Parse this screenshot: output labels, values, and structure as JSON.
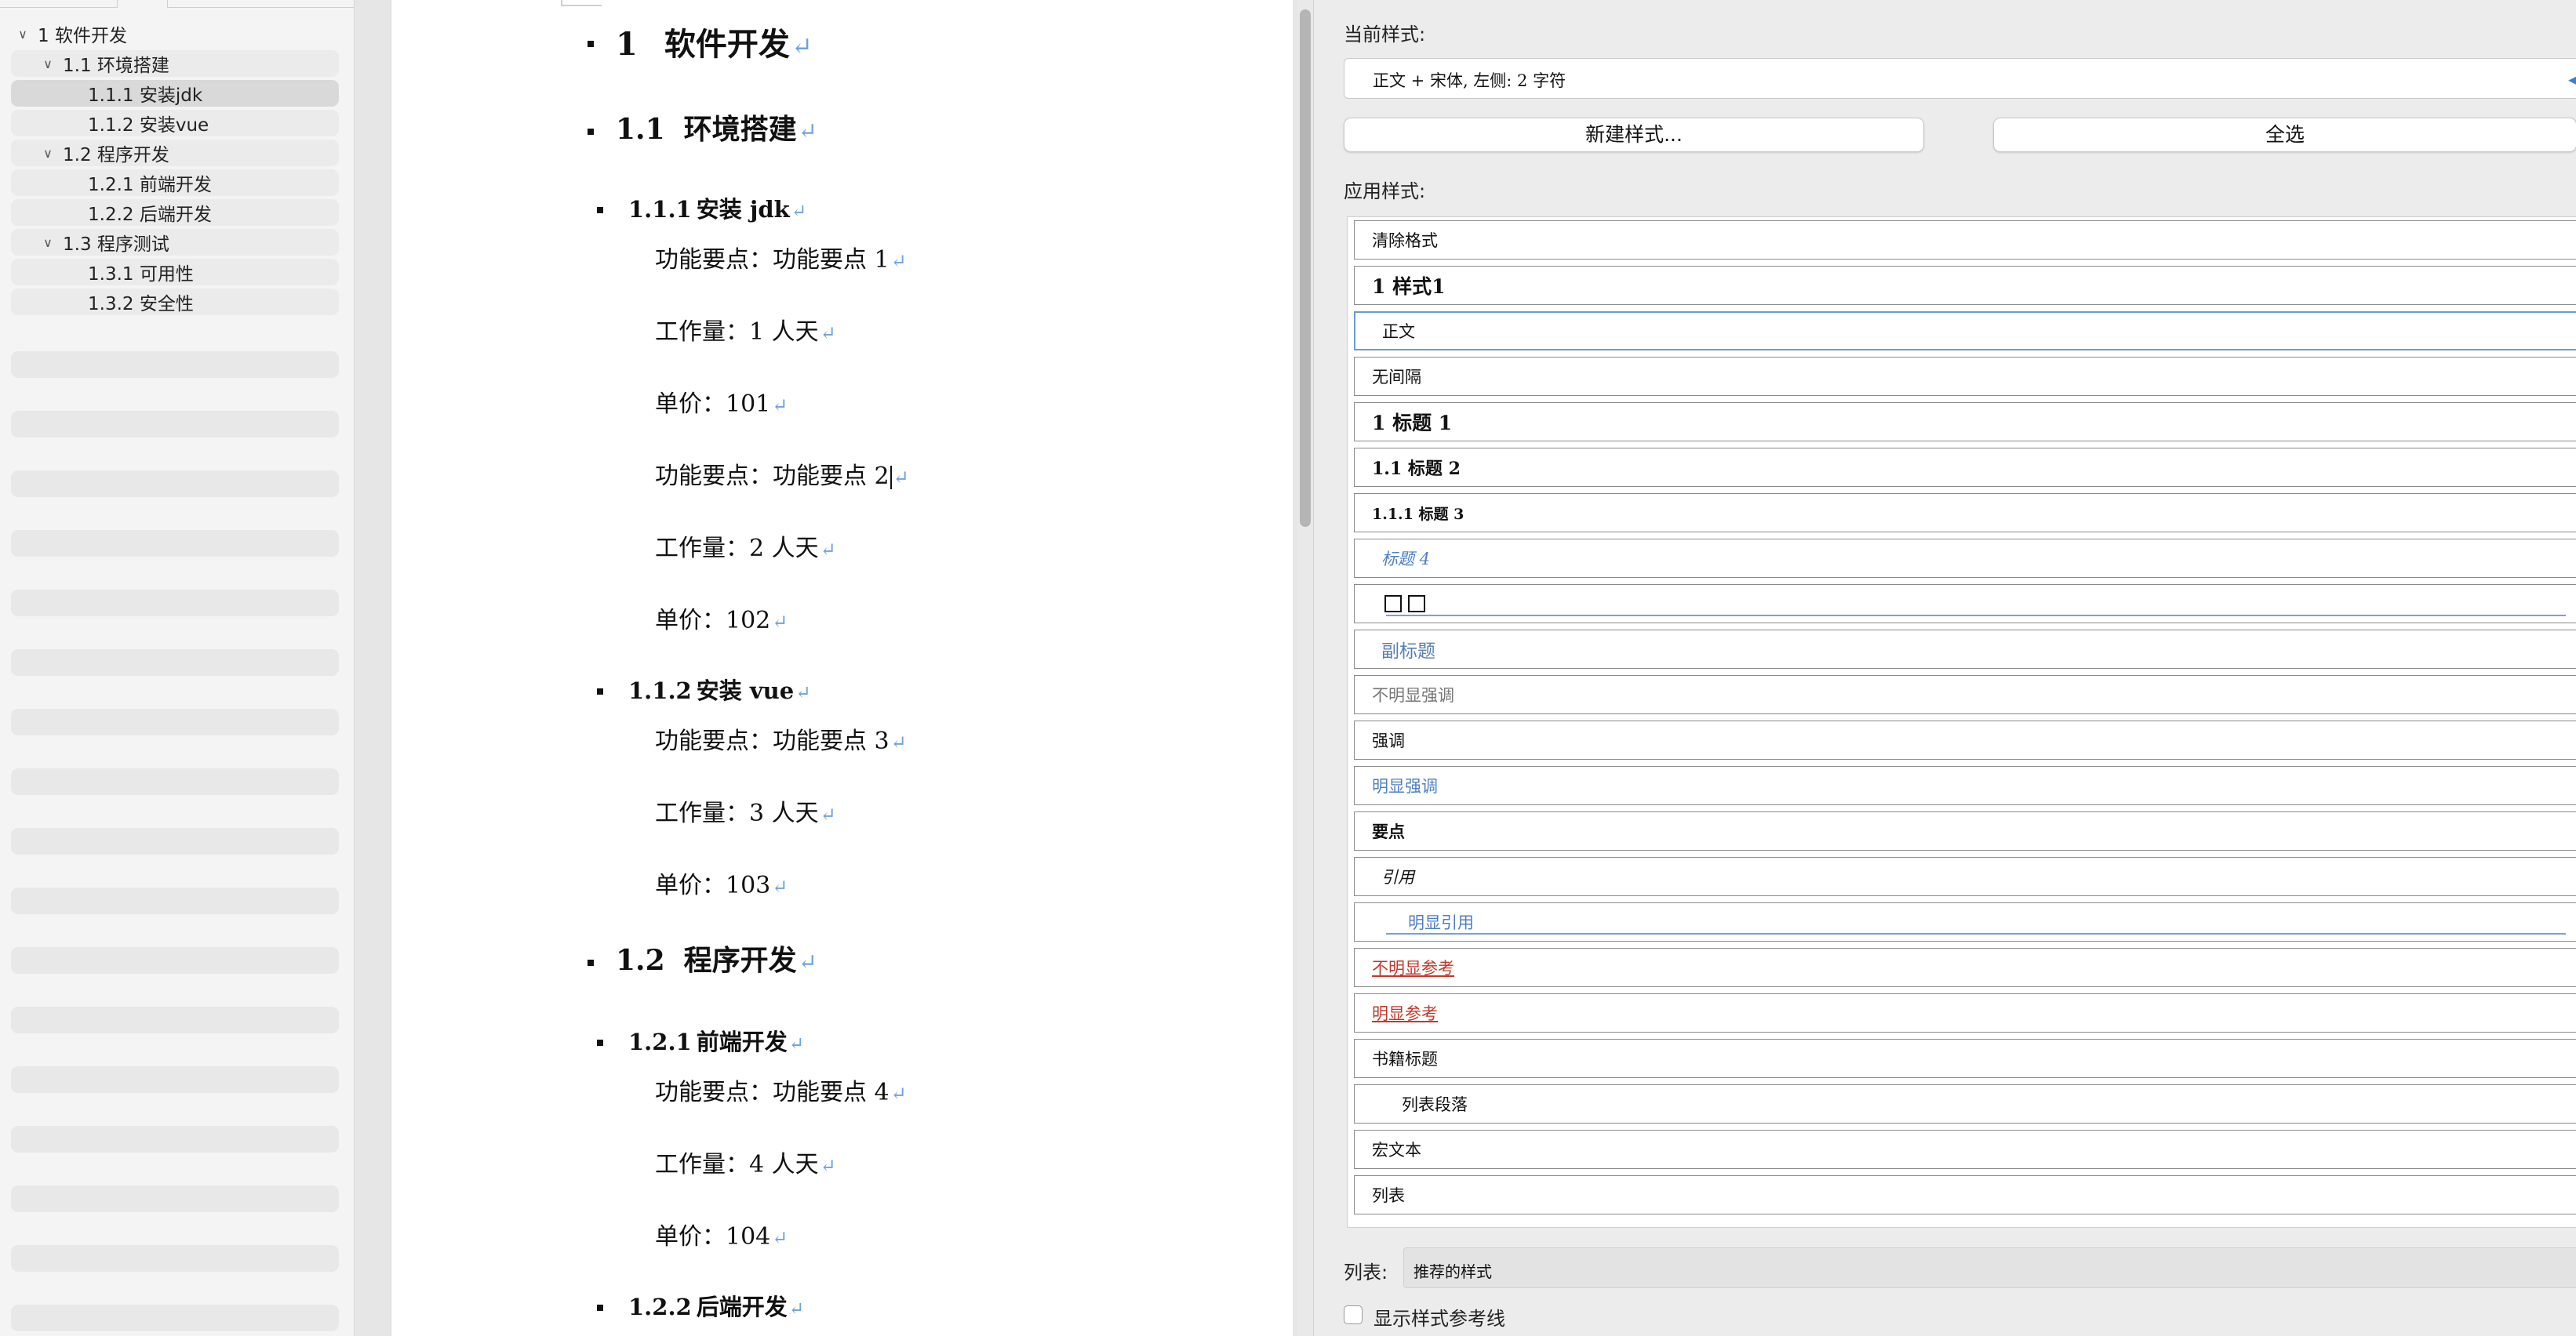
{
  "nav": {
    "items": [
      {
        "label": "1 软件开发",
        "level": 0,
        "expanded": true
      },
      {
        "label": "1.1 环境搭建",
        "level": 1,
        "expanded": true
      },
      {
        "label": "1.1.1 安装jdk",
        "level": 2,
        "selected": true
      },
      {
        "label": "1.1.2 安装vue",
        "level": 2
      },
      {
        "label": "1.2 程序开发",
        "level": 1,
        "expanded": true
      },
      {
        "label": "1.2.1 前端开发",
        "level": 2
      },
      {
        "label": "1.2.2 后端开发",
        "level": 2
      },
      {
        "label": "1.3 程序测试",
        "level": 1,
        "expanded": true
      },
      {
        "label": "1.3.1 可用性",
        "level": 2
      },
      {
        "label": "1.3.2 安全性",
        "level": 2
      }
    ]
  },
  "document": {
    "paragraphs": [
      {
        "type": "h1",
        "num": "1",
        "text": "软件开发"
      },
      {
        "type": "h2",
        "num": "1.1",
        "text": "环境搭建"
      },
      {
        "type": "h3",
        "num": "1.1.1",
        "text": "安装 jdk"
      },
      {
        "type": "body",
        "text": "功能要点：功能要点 1"
      },
      {
        "type": "body",
        "text": "工作量：1 人天"
      },
      {
        "type": "body",
        "text": "单价：101"
      },
      {
        "type": "body",
        "text": "功能要点：功能要点 2",
        "caret": true
      },
      {
        "type": "body",
        "text": "工作量：2 人天"
      },
      {
        "type": "body",
        "text": "单价：102"
      },
      {
        "type": "h3",
        "num": "1.1.2",
        "text": "安装 vue"
      },
      {
        "type": "body",
        "text": "功能要点：功能要点 3"
      },
      {
        "type": "body",
        "text": "工作量：3 人天"
      },
      {
        "type": "body",
        "text": "单价：103"
      },
      {
        "type": "h2",
        "num": "1.2",
        "text": "程序开发"
      },
      {
        "type": "h3",
        "num": "1.2.1",
        "text": "前端开发"
      },
      {
        "type": "body",
        "text": "功能要点：功能要点 4"
      },
      {
        "type": "body",
        "text": "工作量：4 人天"
      },
      {
        "type": "body",
        "text": "单价：104"
      },
      {
        "type": "h3",
        "num": "1.2.2",
        "text": "后端开发"
      }
    ],
    "paragraph_mark": "↵"
  },
  "styles_panel": {
    "current_label": "当前样式:",
    "current_value": "正文 + 宋体, 左侧: 2 字符",
    "new_style_button": "新建样式...",
    "select_all_button": "全选",
    "apply_label": "应用样式:",
    "styles": [
      {
        "label": "清除格式"
      },
      {
        "label": "1  样式1",
        "style": "bold-lg"
      },
      {
        "label": "正文",
        "selected": true
      },
      {
        "label": "无间隔"
      },
      {
        "label": "1  标题 1",
        "style": "bold-lg"
      },
      {
        "label": "1.1  标题 2",
        "style": "bold-md"
      },
      {
        "label": "1.1.1  标题 3",
        "style": "bold-sm"
      },
      {
        "label": "标题 4",
        "style": "blue-italic"
      },
      {
        "label": "",
        "style": "boxes"
      },
      {
        "label": "副标题",
        "style": "blue-lg"
      },
      {
        "label": "不明显强调",
        "style": "gray"
      },
      {
        "label": "强调"
      },
      {
        "label": "明显强调",
        "style": "blue"
      },
      {
        "label": "要点",
        "style": "bold"
      },
      {
        "label": "引用",
        "style": "italic"
      },
      {
        "label": "明显引用",
        "style": "blue-underline"
      },
      {
        "label": "不明显参考",
        "style": "red-underline"
      },
      {
        "label": "明显参考",
        "style": "red-underline"
      },
      {
        "label": "书籍标题"
      },
      {
        "label": "列表段落",
        "style": "indent"
      },
      {
        "label": "宏文本"
      },
      {
        "label": "列表"
      }
    ],
    "list_label": "列表:",
    "list_value": "推荐的样式",
    "guides_label": "显示样式参考线",
    "guides_checked": false
  }
}
